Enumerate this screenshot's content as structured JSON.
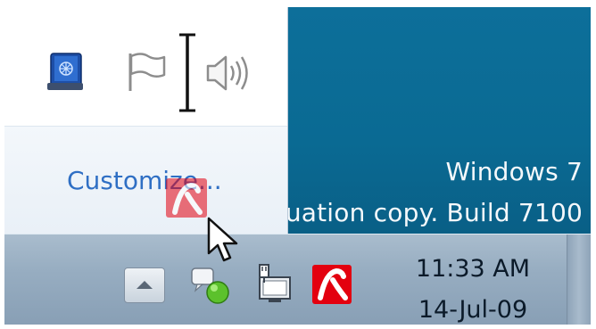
{
  "desktop": {
    "watermark_line1": "Windows 7",
    "watermark_line2": "uation copy. Build 7100"
  },
  "flyout": {
    "icons": [
      "network-drive-icon",
      "action-center-flag-icon",
      "volume-icon"
    ],
    "customize_link": "Customize..."
  },
  "taskbar": {
    "tray_icons": [
      "show-hidden-icons-arrow",
      "messenger-status-icon",
      "network-icon",
      "avira-antivirus-icon"
    ],
    "clock_time": "11:33 AM",
    "clock_date": "14-Jul-09"
  },
  "colors": {
    "desktop": "#0a6a93",
    "link": "#2f6fc4",
    "avira_red": "#e3000f",
    "taskbar": "#97adc1"
  }
}
